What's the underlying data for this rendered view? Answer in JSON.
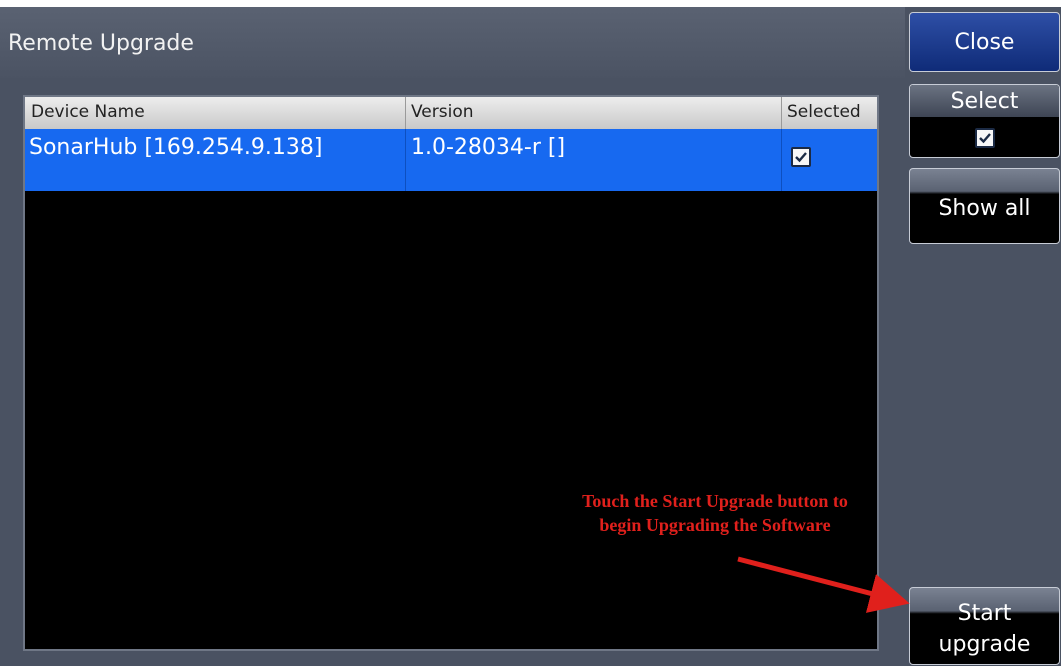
{
  "title": "Remote Upgrade",
  "table": {
    "columns": [
      "Device Name",
      "Version",
      "Selected"
    ],
    "rows": [
      {
        "device_name": "SonarHub  [169.254.9.138]",
        "version": "1.0-28034-r []",
        "selected": true
      }
    ]
  },
  "side_buttons": {
    "close": "Close",
    "select": "Select",
    "select_checked": true,
    "show_all": "Show all",
    "start_line1": "Start",
    "start_line2": "upgrade"
  },
  "annotation": {
    "line1": "Touch the Start Upgrade button to",
    "line2": "begin Upgrading the Software",
    "color": "#e0201c"
  },
  "colors": {
    "selected_row": "#1769f0",
    "close_button": "#1a3a8c",
    "background": "#4a5262"
  }
}
